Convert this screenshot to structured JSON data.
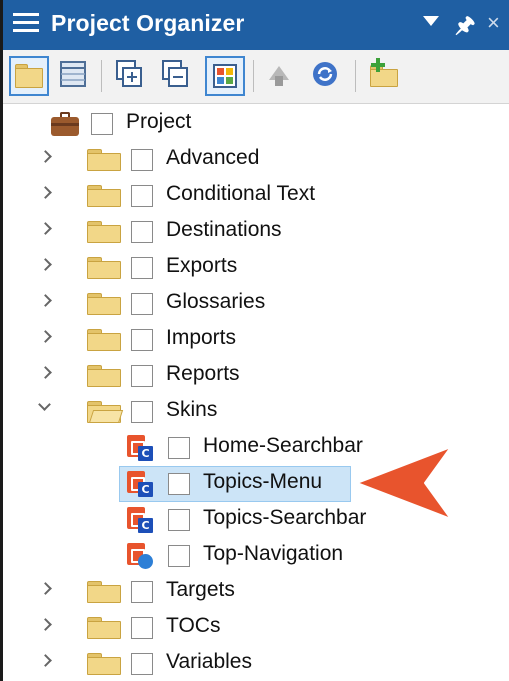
{
  "window": {
    "title": "Project Organizer",
    "controls": {
      "dropdown_icon": "triangle-down-icon",
      "pin_icon": "pin-icon",
      "close_icon": "close-icon"
    }
  },
  "toolbar": {
    "buttons": [
      {
        "icon": "folder-view-icon",
        "selected": true
      },
      {
        "icon": "list-view-icon",
        "selected": false
      },
      {
        "icon": "expand-all-icon",
        "selected": false
      },
      {
        "icon": "collapse-all-icon",
        "selected": false
      },
      {
        "icon": "show-colors-icon",
        "selected": true
      },
      {
        "icon": "bind-to-source-control-icon",
        "selected": false
      },
      {
        "icon": "refresh-icon",
        "selected": false
      },
      {
        "icon": "new-folder-icon",
        "selected": false
      }
    ]
  },
  "tree": {
    "root": {
      "label": "Project"
    },
    "folders": [
      {
        "label": "Advanced",
        "expanded": false
      },
      {
        "label": "Conditional Text",
        "expanded": false
      },
      {
        "label": "Destinations",
        "expanded": false
      },
      {
        "label": "Exports",
        "expanded": false
      },
      {
        "label": "Glossaries",
        "expanded": false
      },
      {
        "label": "Imports",
        "expanded": false
      },
      {
        "label": "Reports",
        "expanded": false
      },
      {
        "label": "Skins",
        "expanded": true
      },
      {
        "label": "Targets",
        "expanded": false
      },
      {
        "label": "TOCs",
        "expanded": false
      },
      {
        "label": "Variables",
        "expanded": false
      }
    ],
    "skins": [
      {
        "label": "Home-Searchbar",
        "badge": "C",
        "selected": false
      },
      {
        "label": "Topics-Menu",
        "badge": "C",
        "selected": true
      },
      {
        "label": "Topics-Searchbar",
        "badge": "C",
        "selected": false
      },
      {
        "label": "Top-Navigation",
        "badge": "",
        "selected": false
      }
    ]
  },
  "colors": {
    "titlebar": "#1f5fa3",
    "selection": "#cce4f7",
    "callout_arrow": "#e8542d"
  }
}
